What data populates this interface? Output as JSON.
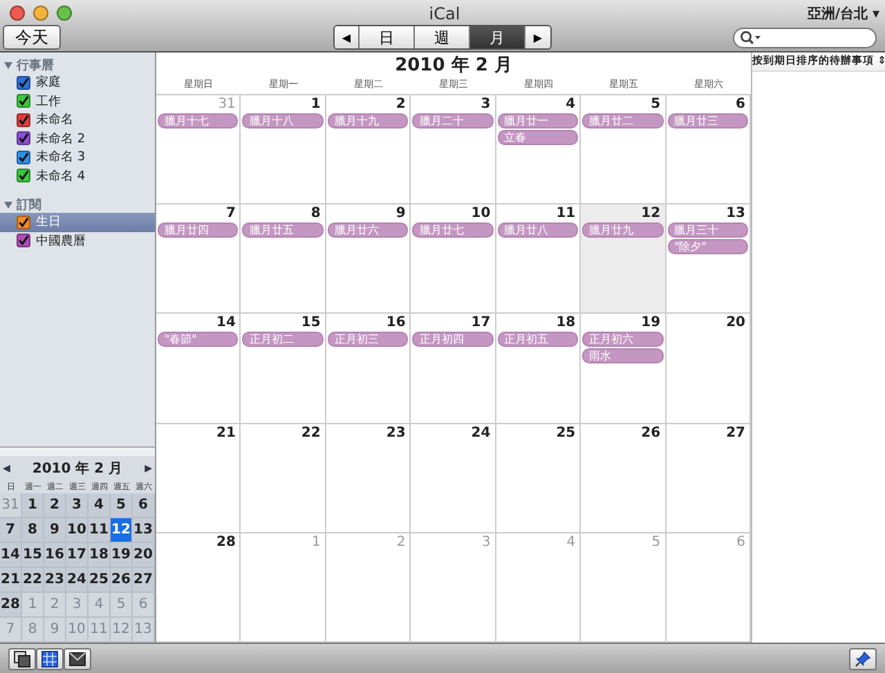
{
  "window": {
    "title": "iCal"
  },
  "toolbar": {
    "today_button": "今天",
    "prev_button": "◀",
    "next_button": "▶",
    "views": [
      {
        "label": "日",
        "selected": false
      },
      {
        "label": "週",
        "selected": false
      },
      {
        "label": "月",
        "selected": true
      }
    ],
    "timezone": "亞洲/台北 ▾"
  },
  "sidebar": {
    "groups": [
      {
        "label": "行事曆",
        "expanded": true,
        "items": [
          {
            "label": "家庭",
            "checked": true,
            "color": "#2f6fdc",
            "selected": false
          },
          {
            "label": "工作",
            "checked": true,
            "color": "#3cc83c",
            "selected": false
          },
          {
            "label": "未命名",
            "checked": true,
            "color": "#e03c3c",
            "selected": false
          },
          {
            "label": "未命名 2",
            "checked": true,
            "color": "#8a4fd0",
            "selected": false
          },
          {
            "label": "未命名 3",
            "checked": true,
            "color": "#2f8fe8",
            "selected": false
          },
          {
            "label": "未命名 4",
            "checked": true,
            "color": "#3cc83c",
            "selected": false
          }
        ]
      },
      {
        "label": "訂閱",
        "expanded": true,
        "items": [
          {
            "label": "生日",
            "checked": true,
            "color": "#f08a24",
            "selected": true
          },
          {
            "label": "中國農曆",
            "checked": true,
            "color": "#b04cb8",
            "selected": false
          }
        ]
      }
    ]
  },
  "mini_calendar": {
    "title": "2010 年 2 月",
    "prev_button": "◀",
    "next_button": "▶",
    "weekdays": [
      "日",
      "週一",
      "週二",
      "週三",
      "週四",
      "週五",
      "週六"
    ],
    "weeks": [
      [
        {
          "day": "31",
          "other_month": true,
          "selected": false
        },
        {
          "day": "1",
          "other_month": false,
          "selected": false
        },
        {
          "day": "2",
          "other_month": false,
          "selected": false
        },
        {
          "day": "3",
          "other_month": false,
          "selected": false
        },
        {
          "day": "4",
          "other_month": false,
          "selected": false
        },
        {
          "day": "5",
          "other_month": false,
          "selected": false
        },
        {
          "day": "6",
          "other_month": false,
          "selected": false
        }
      ],
      [
        {
          "day": "7",
          "other_month": false,
          "selected": false
        },
        {
          "day": "8",
          "other_month": false,
          "selected": false
        },
        {
          "day": "9",
          "other_month": false,
          "selected": false
        },
        {
          "day": "10",
          "other_month": false,
          "selected": false
        },
        {
          "day": "11",
          "other_month": false,
          "selected": false
        },
        {
          "day": "12",
          "other_month": false,
          "selected": true
        },
        {
          "day": "13",
          "other_month": false,
          "selected": false
        }
      ],
      [
        {
          "day": "14",
          "other_month": false,
          "selected": false
        },
        {
          "day": "15",
          "other_month": false,
          "selected": false
        },
        {
          "day": "16",
          "other_month": false,
          "selected": false
        },
        {
          "day": "17",
          "other_month": false,
          "selected": false
        },
        {
          "day": "18",
          "other_month": false,
          "selected": false
        },
        {
          "day": "19",
          "other_month": false,
          "selected": false
        },
        {
          "day": "20",
          "other_month": false,
          "selected": false
        }
      ],
      [
        {
          "day": "21",
          "other_month": false,
          "selected": false
        },
        {
          "day": "22",
          "other_month": false,
          "selected": false
        },
        {
          "day": "23",
          "other_month": false,
          "selected": false
        },
        {
          "day": "24",
          "other_month": false,
          "selected": false
        },
        {
          "day": "25",
          "other_month": false,
          "selected": false
        },
        {
          "day": "26",
          "other_month": false,
          "selected": false
        },
        {
          "day": "27",
          "other_month": false,
          "selected": false
        }
      ],
      [
        {
          "day": "28",
          "other_month": false,
          "selected": false
        },
        {
          "day": "1",
          "other_month": true,
          "selected": false
        },
        {
          "day": "2",
          "other_month": true,
          "selected": false
        },
        {
          "day": "3",
          "other_month": true,
          "selected": false
        },
        {
          "day": "4",
          "other_month": true,
          "selected": false
        },
        {
          "day": "5",
          "other_month": true,
          "selected": false
        },
        {
          "day": "6",
          "other_month": true,
          "selected": false
        }
      ],
      [
        {
          "day": "7",
          "other_month": true,
          "selected": false
        },
        {
          "day": "8",
          "other_month": true,
          "selected": false
        },
        {
          "day": "9",
          "other_month": true,
          "selected": false
        },
        {
          "day": "10",
          "other_month": true,
          "selected": false
        },
        {
          "day": "11",
          "other_month": true,
          "selected": false
        },
        {
          "day": "12",
          "other_month": true,
          "selected": false
        },
        {
          "day": "13",
          "other_month": true,
          "selected": false
        }
      ]
    ]
  },
  "month_view": {
    "title": "2010 年 2 月",
    "weekdays": [
      "星期日",
      "星期一",
      "星期二",
      "星期三",
      "星期四",
      "星期五",
      "星期六"
    ],
    "weeks": [
      [
        {
          "day": "31",
          "other_month": true,
          "selected": false,
          "events": [
            "臘月十七"
          ]
        },
        {
          "day": "1",
          "other_month": false,
          "selected": false,
          "events": [
            "臘月十八"
          ]
        },
        {
          "day": "2",
          "other_month": false,
          "selected": false,
          "events": [
            "臘月十九"
          ]
        },
        {
          "day": "3",
          "other_month": false,
          "selected": false,
          "events": [
            "臘月二十"
          ]
        },
        {
          "day": "4",
          "other_month": false,
          "selected": false,
          "events": [
            "臘月廿一",
            "立春"
          ]
        },
        {
          "day": "5",
          "other_month": false,
          "selected": false,
          "events": [
            "臘月廿二"
          ]
        },
        {
          "day": "6",
          "other_month": false,
          "selected": false,
          "events": [
            "臘月廿三"
          ]
        }
      ],
      [
        {
          "day": "7",
          "other_month": false,
          "selected": false,
          "events": [
            "臘月廿四"
          ]
        },
        {
          "day": "8",
          "other_month": false,
          "selected": false,
          "events": [
            "臘月廿五"
          ]
        },
        {
          "day": "9",
          "other_month": false,
          "selected": false,
          "events": [
            "臘月廿六"
          ]
        },
        {
          "day": "10",
          "other_month": false,
          "selected": false,
          "events": [
            "臘月廿七"
          ]
        },
        {
          "day": "11",
          "other_month": false,
          "selected": false,
          "events": [
            "臘月廿八"
          ]
        },
        {
          "day": "12",
          "other_month": false,
          "selected": true,
          "events": [
            "臘月廿九"
          ]
        },
        {
          "day": "13",
          "other_month": false,
          "selected": false,
          "events": [
            "臘月三十",
            "\"除夕\""
          ]
        }
      ],
      [
        {
          "day": "14",
          "other_month": false,
          "selected": false,
          "events": [
            "\"春節\""
          ]
        },
        {
          "day": "15",
          "other_month": false,
          "selected": false,
          "events": [
            "正月初二"
          ]
        },
        {
          "day": "16",
          "other_month": false,
          "selected": false,
          "events": [
            "正月初三"
          ]
        },
        {
          "day": "17",
          "other_month": false,
          "selected": false,
          "events": [
            "正月初四"
          ]
        },
        {
          "day": "18",
          "other_month": false,
          "selected": false,
          "events": [
            "正月初五"
          ]
        },
        {
          "day": "19",
          "other_month": false,
          "selected": false,
          "events": [
            "正月初六",
            "雨水"
          ]
        },
        {
          "day": "20",
          "other_month": false,
          "selected": false
        }
      ],
      [
        {
          "day": "21",
          "other_month": false,
          "selected": false
        },
        {
          "day": "22",
          "other_month": false,
          "selected": false
        },
        {
          "day": "23",
          "other_month": false,
          "selected": false
        },
        {
          "day": "24",
          "other_month": false,
          "selected": false
        },
        {
          "day": "25",
          "other_month": false,
          "selected": false
        },
        {
          "day": "26",
          "other_month": false,
          "selected": false
        },
        {
          "day": "27",
          "other_month": false,
          "selected": false
        }
      ],
      [
        {
          "day": "28",
          "other_month": false,
          "selected": false
        },
        {
          "day": "1",
          "other_month": true,
          "selected": false
        },
        {
          "day": "2",
          "other_month": true,
          "selected": false
        },
        {
          "day": "3",
          "other_month": true,
          "selected": false
        },
        {
          "day": "4",
          "other_month": true,
          "selected": false
        },
        {
          "day": "5",
          "other_month": true,
          "selected": false
        },
        {
          "day": "6",
          "other_month": true,
          "selected": false
        }
      ]
    ]
  },
  "todo_panel": {
    "sort_menu": "按到期日排序的待辦事項 ⇕"
  }
}
